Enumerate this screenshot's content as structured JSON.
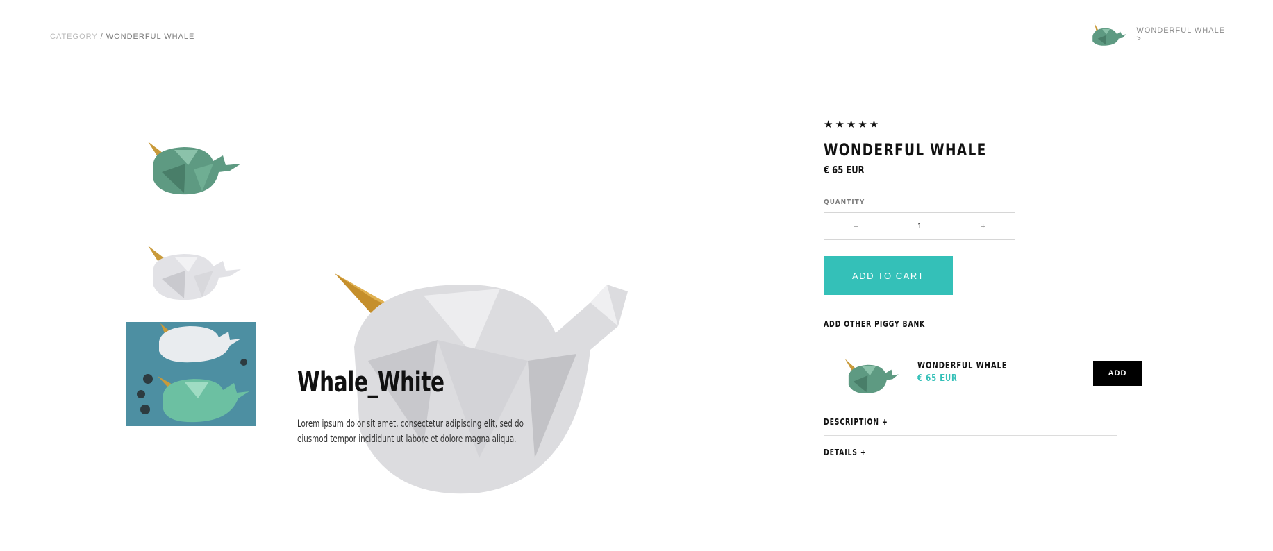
{
  "breadcrumb": {
    "category": "CATEGORY",
    "separator": "/",
    "current": "WONDERFUL WHALE"
  },
  "next_product": {
    "label": "WONDERFUL WHALE >",
    "icon": "whale-green"
  },
  "gallery": {
    "thumbnails": [
      {
        "icon": "whale-green"
      },
      {
        "icon": "whale-white"
      },
      {
        "icon": "whales-photo"
      }
    ],
    "hero_icon": "whale-white",
    "overlay_title": "Whale_White",
    "overlay_description": "Lorem ipsum dolor sit amet, consectetur adipiscing elit, sed do eiusmod tempor incididunt ut labore et dolore magna aliqua."
  },
  "product": {
    "stars": "★★★★★",
    "title": "WONDERFUL WHALE",
    "price": "€ 65 EUR",
    "quantity_label": "QUANTITY",
    "quantity_value": "1",
    "minus": "−",
    "plus": "+",
    "add_to_cart": "ADD TO CART"
  },
  "upsell": {
    "heading": "ADD OTHER PIGGY BANK",
    "item": {
      "name": "WONDERFUL WHALE",
      "price": "€ 65 EUR",
      "add": "ADD",
      "icon": "whale-green"
    }
  },
  "accordion": [
    {
      "label": "DESCRIPTION +"
    },
    {
      "label": "DETAILS +"
    }
  ],
  "colors": {
    "accent": "#34c0b8",
    "dark": "#000000",
    "muted": "#8a8a8a"
  }
}
